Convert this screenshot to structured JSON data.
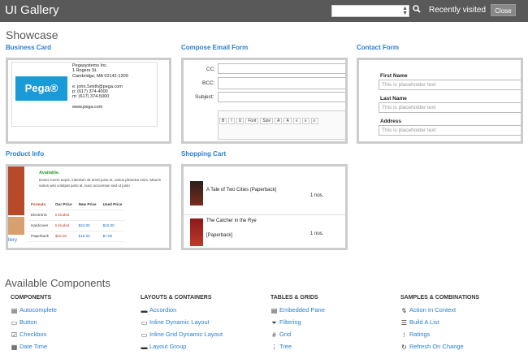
{
  "app": {
    "title": "UI Gallery",
    "recently_visited": "Recently visited",
    "close": "Close"
  },
  "showcase": {
    "heading": "Showcase"
  },
  "business_card": {
    "title": "Business Card",
    "logo": "Pega®",
    "lines": [
      "Pegasystems Inc.",
      "1 Rogers St.",
      "Cambridge, MA 02142-1209",
      "",
      "e: john.Smith@pega.com",
      "p: (617) 374-4000",
      "m: (617) 374-5000",
      "",
      "www.pega.com"
    ]
  },
  "compose_email": {
    "title": "Compose Email Form",
    "cc_label": "CC:",
    "bcc_label": "BCC:",
    "subject_label": "Subject:",
    "toolbar": [
      "B",
      "I",
      "U",
      "Font",
      "Size",
      "A",
      "A",
      "≡",
      "≡",
      "≡"
    ]
  },
  "contact_form": {
    "title": "Contact Form",
    "fields": [
      {
        "label": "First Name",
        "placeholder": "This is placeholder text"
      },
      {
        "label": "Last Name",
        "placeholder": "This is placeholder text"
      },
      {
        "label": "Address",
        "placeholder": "This is placeholder text"
      }
    ]
  },
  "product_info": {
    "title": "Product Info",
    "product_heading": "Available.",
    "desc": "Donec lorem turpis, interdum sit amet justo et, varius pharetra enim. Mauris varius wisi volutpat justo at, nunc accumsan sed ut justo",
    "headers": [
      "Formats",
      "Our Price",
      "New Price",
      "Used Price"
    ],
    "rows": [
      [
        "Electronic",
        "Included",
        "",
        ""
      ],
      [
        "Hardcover",
        "Included",
        "$24.00",
        "$10.00"
      ],
      [
        "Paperback",
        "$16.00",
        "$15.00",
        "$7.00"
      ]
    ],
    "side_link": "llery"
  },
  "shopping_cart": {
    "title": "Shopping Cart",
    "items": [
      {
        "name": "A Tale of Two Cities (Paperback)",
        "qty": "1 nos."
      },
      {
        "name": "The Catcher in the Rye",
        "sub": "[Paperback]",
        "qty": "1 nos."
      }
    ]
  },
  "available": {
    "heading": "Available Components",
    "columns": [
      {
        "header": "COMPONENTS",
        "items": [
          {
            "icon": "autocomplete-icon",
            "glyph": "▤",
            "label": "Autocomplete"
          },
          {
            "icon": "button-icon",
            "glyph": "▭",
            "label": "Button"
          },
          {
            "icon": "checkbox-icon",
            "glyph": "☑",
            "label": "Checkbox"
          },
          {
            "icon": "calendar-icon",
            "glyph": "▦",
            "label": "Date Time"
          }
        ]
      },
      {
        "header": "LAYOUTS & CONTAINERS",
        "items": [
          {
            "icon": "accordion-icon",
            "glyph": "▬",
            "label": "Accordion"
          },
          {
            "icon": "inline-layout-icon",
            "glyph": "▭",
            "label": "Inline Dynamic Layout"
          },
          {
            "icon": "inline-grid-icon",
            "glyph": "▭",
            "label": "Inline Grid Dynamic Layout"
          },
          {
            "icon": "layout-group-icon",
            "glyph": "▬",
            "label": "Layout Group"
          }
        ]
      },
      {
        "header": "TABLES & GRIDS",
        "items": [
          {
            "icon": "embedded-pane-icon",
            "glyph": "▤",
            "label": "Embedded Pane"
          },
          {
            "icon": "filter-icon",
            "glyph": "⏷",
            "label": "Filtering"
          },
          {
            "icon": "grid-icon",
            "glyph": "#",
            "label": "Grid"
          },
          {
            "icon": "tree-icon",
            "glyph": "⋮",
            "label": "Tree"
          }
        ]
      },
      {
        "header": "SAMPLES & COMBINATIONS",
        "items": [
          {
            "icon": "action-icon",
            "glyph": "↯",
            "label": "Action In Context"
          },
          {
            "icon": "list-icon",
            "glyph": "☰",
            "label": "Build A List"
          },
          {
            "icon": "ratings-icon",
            "glyph": "⁝",
            "label": "Ratings"
          },
          {
            "icon": "refresh-icon",
            "glyph": "↻",
            "label": "Refresh On Change"
          }
        ]
      }
    ]
  }
}
